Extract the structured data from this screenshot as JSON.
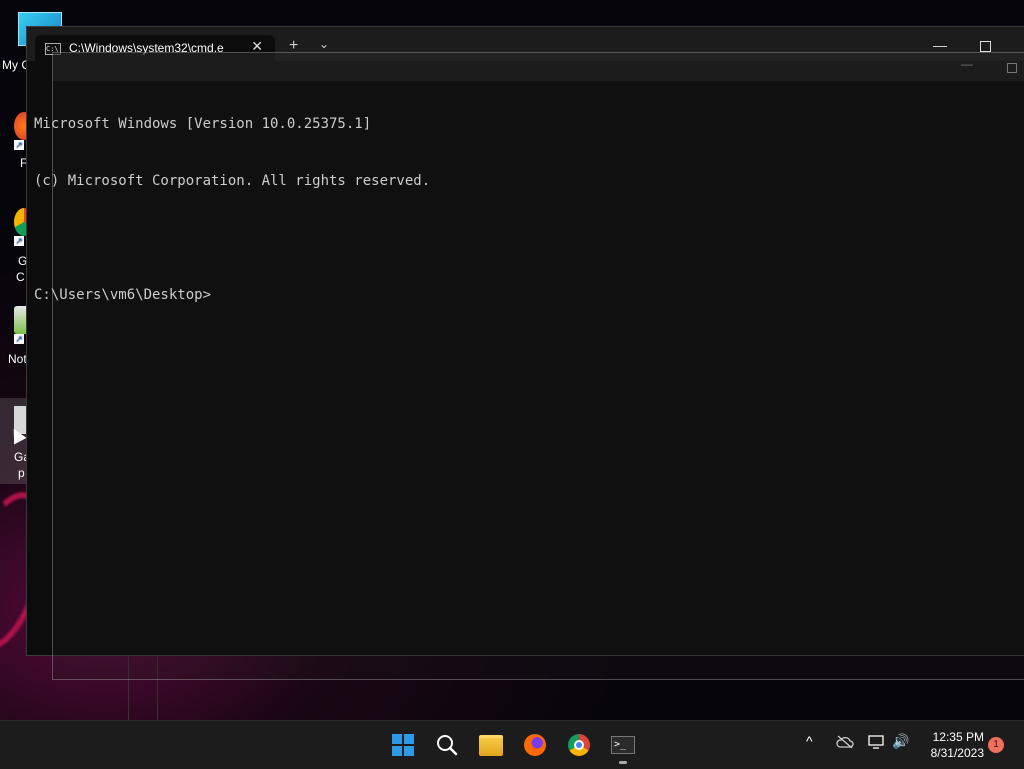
{
  "desktop": {
    "icons": [
      {
        "label": "My C"
      },
      {
        "label": "F"
      },
      {
        "label": "G"
      },
      {
        "label": "C"
      },
      {
        "label": "Not"
      },
      {
        "label": "Ga"
      },
      {
        "label": "p"
      }
    ]
  },
  "terminal": {
    "tab_title": "C:\\Windows\\system32\\cmd.e",
    "tab_icon_text": "C:\\",
    "new_tab": "+",
    "dropdown": "⌄",
    "close": "✕",
    "minimize": "—",
    "lines": [
      "Microsoft Windows [Version 10.0.25375.1]",
      "(c) Microsoft Corporation. All rights reserved.",
      "",
      "C:\\Users\\vm6\\Desktop>"
    ]
  },
  "cmd_ghost": {
    "minimize": "—"
  },
  "taskbar": {
    "items": [
      "start-icon",
      "search-icon",
      "file-explorer-icon",
      "firefox-icon",
      "chrome-icon",
      "terminal-icon"
    ],
    "tray": {
      "chevron": "^",
      "volume": "🔊"
    },
    "time": "12:35 PM",
    "date": "8/31/2023",
    "notification_count": "1",
    "accent": "#2b9be8"
  }
}
